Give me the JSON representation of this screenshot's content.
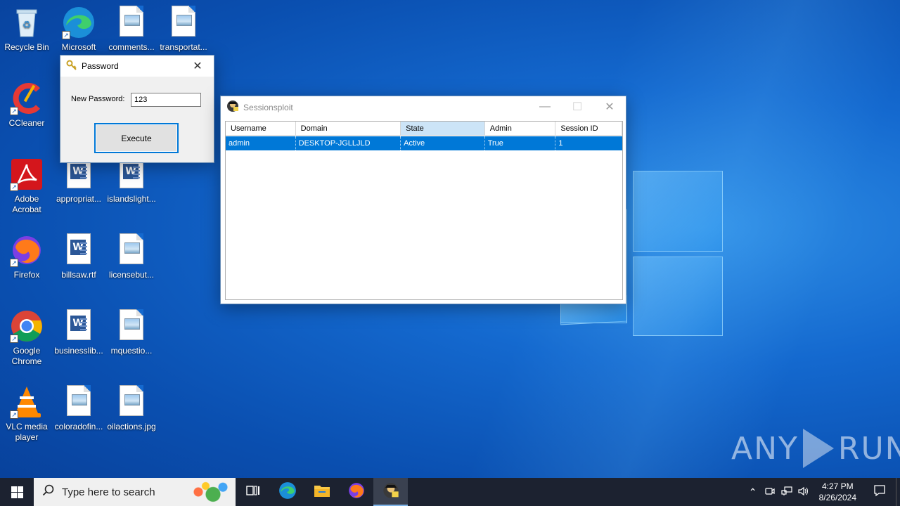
{
  "desktop": {
    "icons": [
      {
        "label": "Recycle Bin"
      },
      {
        "label": "Microsoft Edge"
      },
      {
        "label": "comments..."
      },
      {
        "label": "transportat..."
      },
      {
        "label": "CCleaner"
      },
      {
        "label": "Adobe Acrobat"
      },
      {
        "label": "appropriat..."
      },
      {
        "label": "islandslight..."
      },
      {
        "label": "Firefox"
      },
      {
        "label": "billsaw.rtf"
      },
      {
        "label": "licensebut..."
      },
      {
        "label": "Google Chrome"
      },
      {
        "label": "businesslib..."
      },
      {
        "label": "mquestio..."
      },
      {
        "label": "VLC media player"
      },
      {
        "label": "coloradofin..."
      },
      {
        "label": "oilactions.jpg"
      }
    ]
  },
  "password_dialog": {
    "title": "Password",
    "label": "New Password:",
    "value": "123",
    "button": "Execute"
  },
  "sessionsploit": {
    "title": "Sessionsploit",
    "columns": [
      "Username",
      "Domain",
      "State",
      "Admin",
      "Session ID"
    ],
    "rows": [
      [
        "admin",
        "DESKTOP-JGLLJLD",
        "Active",
        "True",
        "1"
      ]
    ]
  },
  "watermark": {
    "left": "ANY",
    "right": "RUN"
  },
  "taskbar": {
    "search_placeholder": "Type here to search",
    "time": "4:27 PM",
    "date": "8/26/2024"
  },
  "colors": {
    "accent": "#0078d7",
    "taskbar": "#1c2230"
  }
}
